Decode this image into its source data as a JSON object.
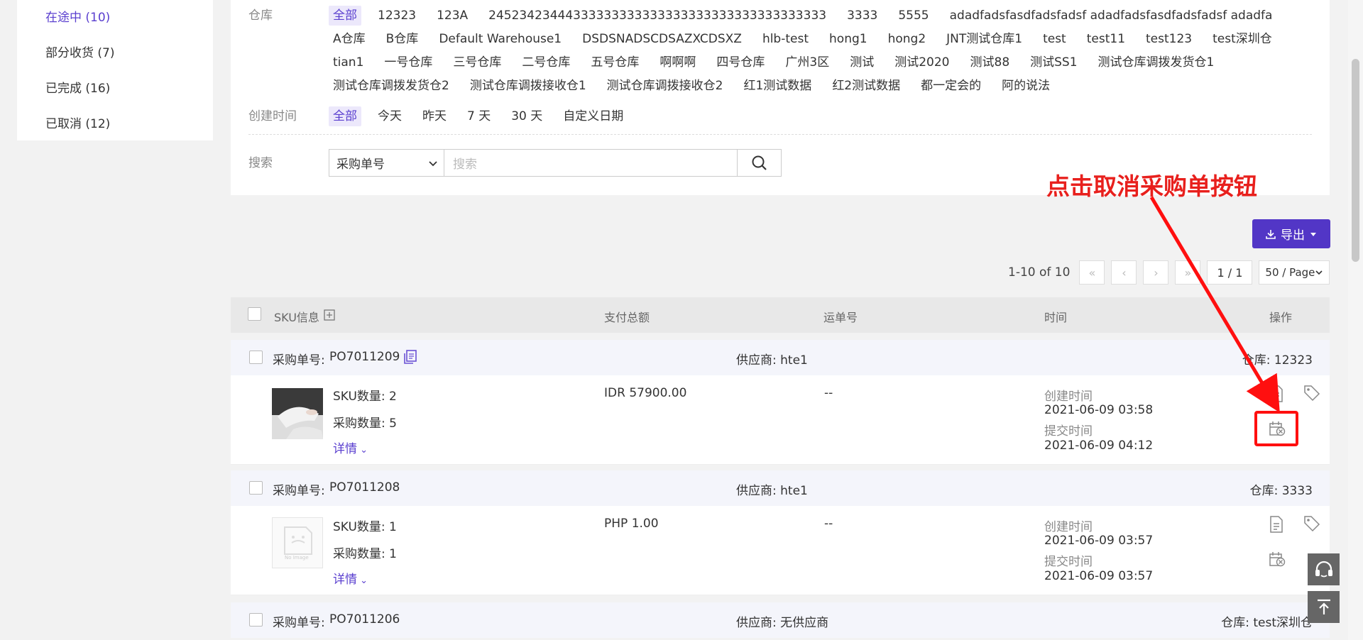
{
  "sidebar": {
    "items": [
      {
        "label": "在途中 (10)",
        "active": true
      },
      {
        "label": "部分收货 (7)"
      },
      {
        "label": "已完成 (16)"
      },
      {
        "label": "已取消 (12)"
      }
    ]
  },
  "filters": {
    "warehouse_label": "仓库",
    "warehouses": [
      "全部",
      "12323",
      "123A",
      "24523423444333333333333333333333333333333333",
      "3333",
      "5555",
      "adadfadsfasdfadsfadsf adadfadsfasdfadsfadsf adadfa",
      "A仓库",
      "B仓库",
      "Default Warehouse1",
      "DSDSNADSCDSAZXCDSXZ",
      "hlb-test",
      "hong1",
      "hong2",
      "JNT测试仓库1",
      "test",
      "test11",
      "test123",
      "test深圳仓",
      "tian1",
      "一号仓库",
      "三号仓库",
      "二号仓库",
      "五号仓库",
      "啊啊啊",
      "四号仓库",
      "广州3区",
      "测试",
      "测试2020",
      "测试88",
      "测试SS1",
      "测试仓库调拨发货仓1",
      "测试仓库调拨发货仓2",
      "测试仓库调拨接收仓1",
      "测试仓库调拨接收仓2",
      "红1测试数据",
      "红2测试数据",
      "都一定会的",
      "阿的说法"
    ],
    "created_label": "创建时间",
    "created_options": [
      "全部",
      "今天",
      "昨天",
      "7 天",
      "30 天",
      "自定义日期"
    ],
    "search_label": "搜索",
    "search_type": "采购单号",
    "search_placeholder": "搜索"
  },
  "toolbar": {
    "export_label": "导出"
  },
  "pager": {
    "summary": "1-10 of 10",
    "page": "1 / 1",
    "page_size": "50 / Page"
  },
  "table": {
    "columns": {
      "sku": "SKU信息",
      "amount": "支付总额",
      "tracking": "运单号",
      "time": "时间",
      "actions": "操作"
    }
  },
  "orders": [
    {
      "po_label": "采购单号:",
      "po": "PO7011209",
      "supplier": "供应商: hte1",
      "warehouse": "仓库: 12323",
      "sku_count": "SKU数量: 2",
      "qty": "采购数量: 5",
      "detail": "详情",
      "amount": "IDR 57900.00",
      "tracking": "--",
      "created_label": "创建时间",
      "created": "2021-06-09 03:58",
      "submitted_label": "提交时间",
      "submitted": "2021-06-09 04:12",
      "image": "photo"
    },
    {
      "po_label": "采购单号:",
      "po": "PO7011208",
      "supplier": "供应商: hte1",
      "warehouse": "仓库: 3333",
      "sku_count": "SKU数量: 1",
      "qty": "采购数量: 1",
      "detail": "详情",
      "amount": "PHP 1.00",
      "tracking": "--",
      "created_label": "创建时间",
      "created": "2021-06-09 03:57",
      "submitted_label": "提交时间",
      "submitted": "2021-06-09 03:57",
      "image": "no-image",
      "no_image_text": "No Image"
    },
    {
      "po_label": "采购单号:",
      "po": "PO7011206",
      "supplier": "供应商: 无供应商",
      "warehouse": "仓库: test深圳仓"
    }
  ],
  "annotation": {
    "text": "点击取消采购单按钮",
    "color": "#e8201d"
  },
  "colors": {
    "accent": "#5a3fcf",
    "primary_button": "#5236c6",
    "highlight_box": "#ff0f0f"
  }
}
